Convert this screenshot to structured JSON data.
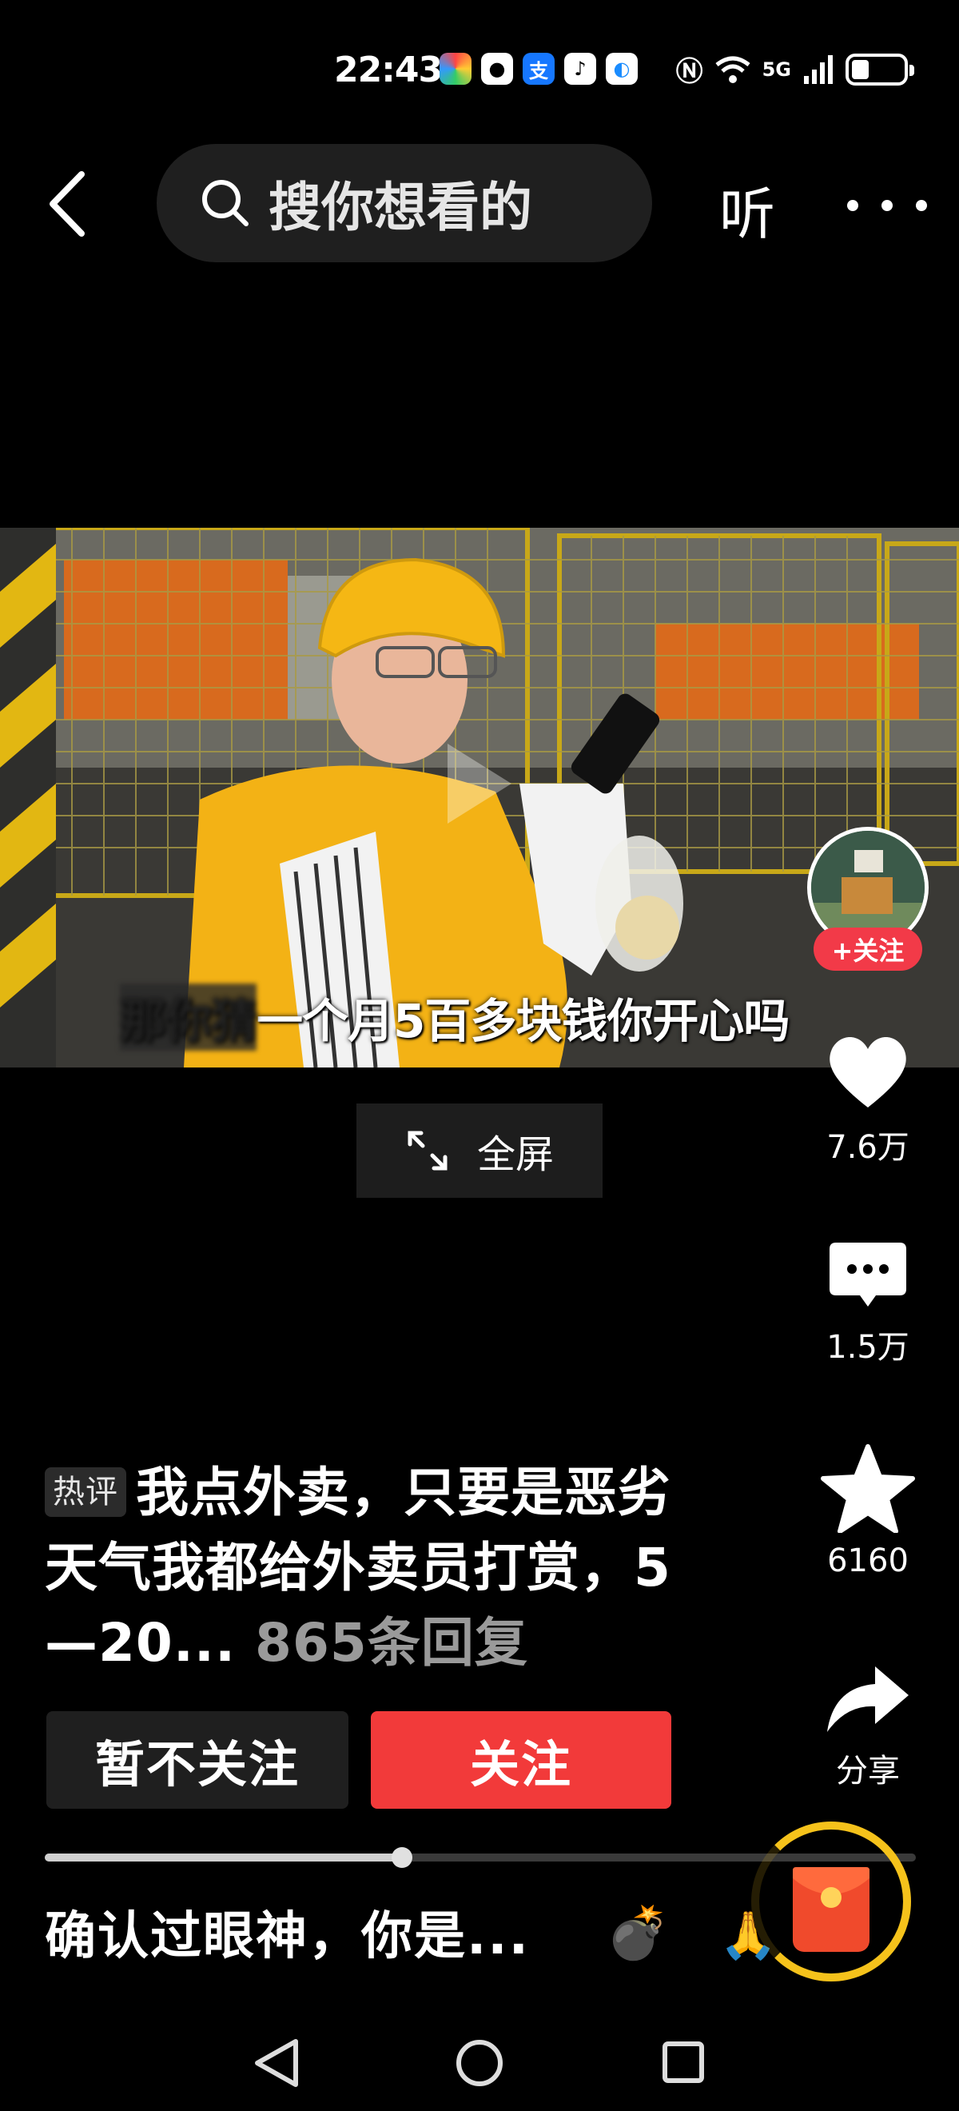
{
  "status_bar": {
    "time": "22:43",
    "network": "5G",
    "app_icons": [
      {
        "name": "colorful-app-icon",
        "color": "#ffffff"
      },
      {
        "name": "qq-icon",
        "color": "#ffffff"
      },
      {
        "name": "alipay-icon",
        "color": "#1677ff"
      },
      {
        "name": "tiktok-icon",
        "color": "#ffffff"
      },
      {
        "name": "browser-icon",
        "color": "#ffffff"
      }
    ]
  },
  "top_nav": {
    "search_placeholder": "搜你想看的",
    "listen_label": "听"
  },
  "video": {
    "subtitle_hidden": "那你猜",
    "subtitle": "一个月5百多块钱你开心吗"
  },
  "fullscreen": {
    "label": "全屏"
  },
  "right_rail": {
    "follow_label": "+关注",
    "likes": "7.6万",
    "comments": "1.5万",
    "favorites": "6160",
    "share_label": "分享"
  },
  "caption": {
    "tag": "热评",
    "text": "我点外卖，只要是恶劣天气我都给外卖员打赏，5—20...",
    "reply_count": "865条回复"
  },
  "actions": {
    "dismiss_label": "暂不关注",
    "follow_label": "关注"
  },
  "progress": {
    "fraction": 0.41
  },
  "bottom_bar": {
    "comment_text": "确认过眼神，你是..."
  },
  "colors": {
    "accent_red": "#f23a3a",
    "ring_gold": "#f5c21b",
    "background": "#000000"
  }
}
